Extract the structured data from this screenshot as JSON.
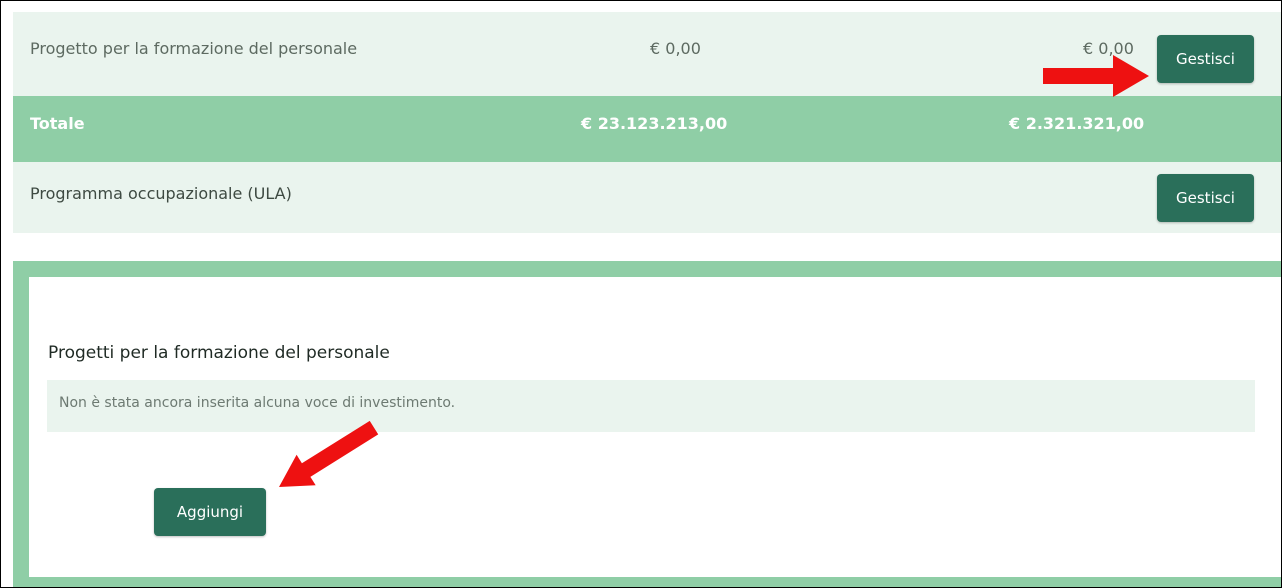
{
  "rows": {
    "training": {
      "label": "Progetto per la formazione del personale",
      "amount_1": "€ 0,00",
      "amount_2": "€ 0,00",
      "button": "Gestisci"
    },
    "total": {
      "label": "Totale",
      "amount_1": "€ 23.123.213,00",
      "amount_2": "€ 2.321.321,00"
    },
    "ula": {
      "label": "Programma occupazionale (ULA)",
      "button": "Gestisci"
    }
  },
  "panel": {
    "title": "Progetti per la formazione del personale",
    "empty_message": "Non è stata ancora inserita alcuna voce di investimento.",
    "add_button": "Aggiungi"
  },
  "colors": {
    "accent_green": "#8fcea6",
    "row_bg": "#eaf4ee",
    "button_bg": "#2a6f5a",
    "arrow_red": "#ee1111"
  },
  "icons": {
    "arrow_1": "red-arrow-right-icon",
    "arrow_2": "red-arrow-down-left-icon"
  }
}
